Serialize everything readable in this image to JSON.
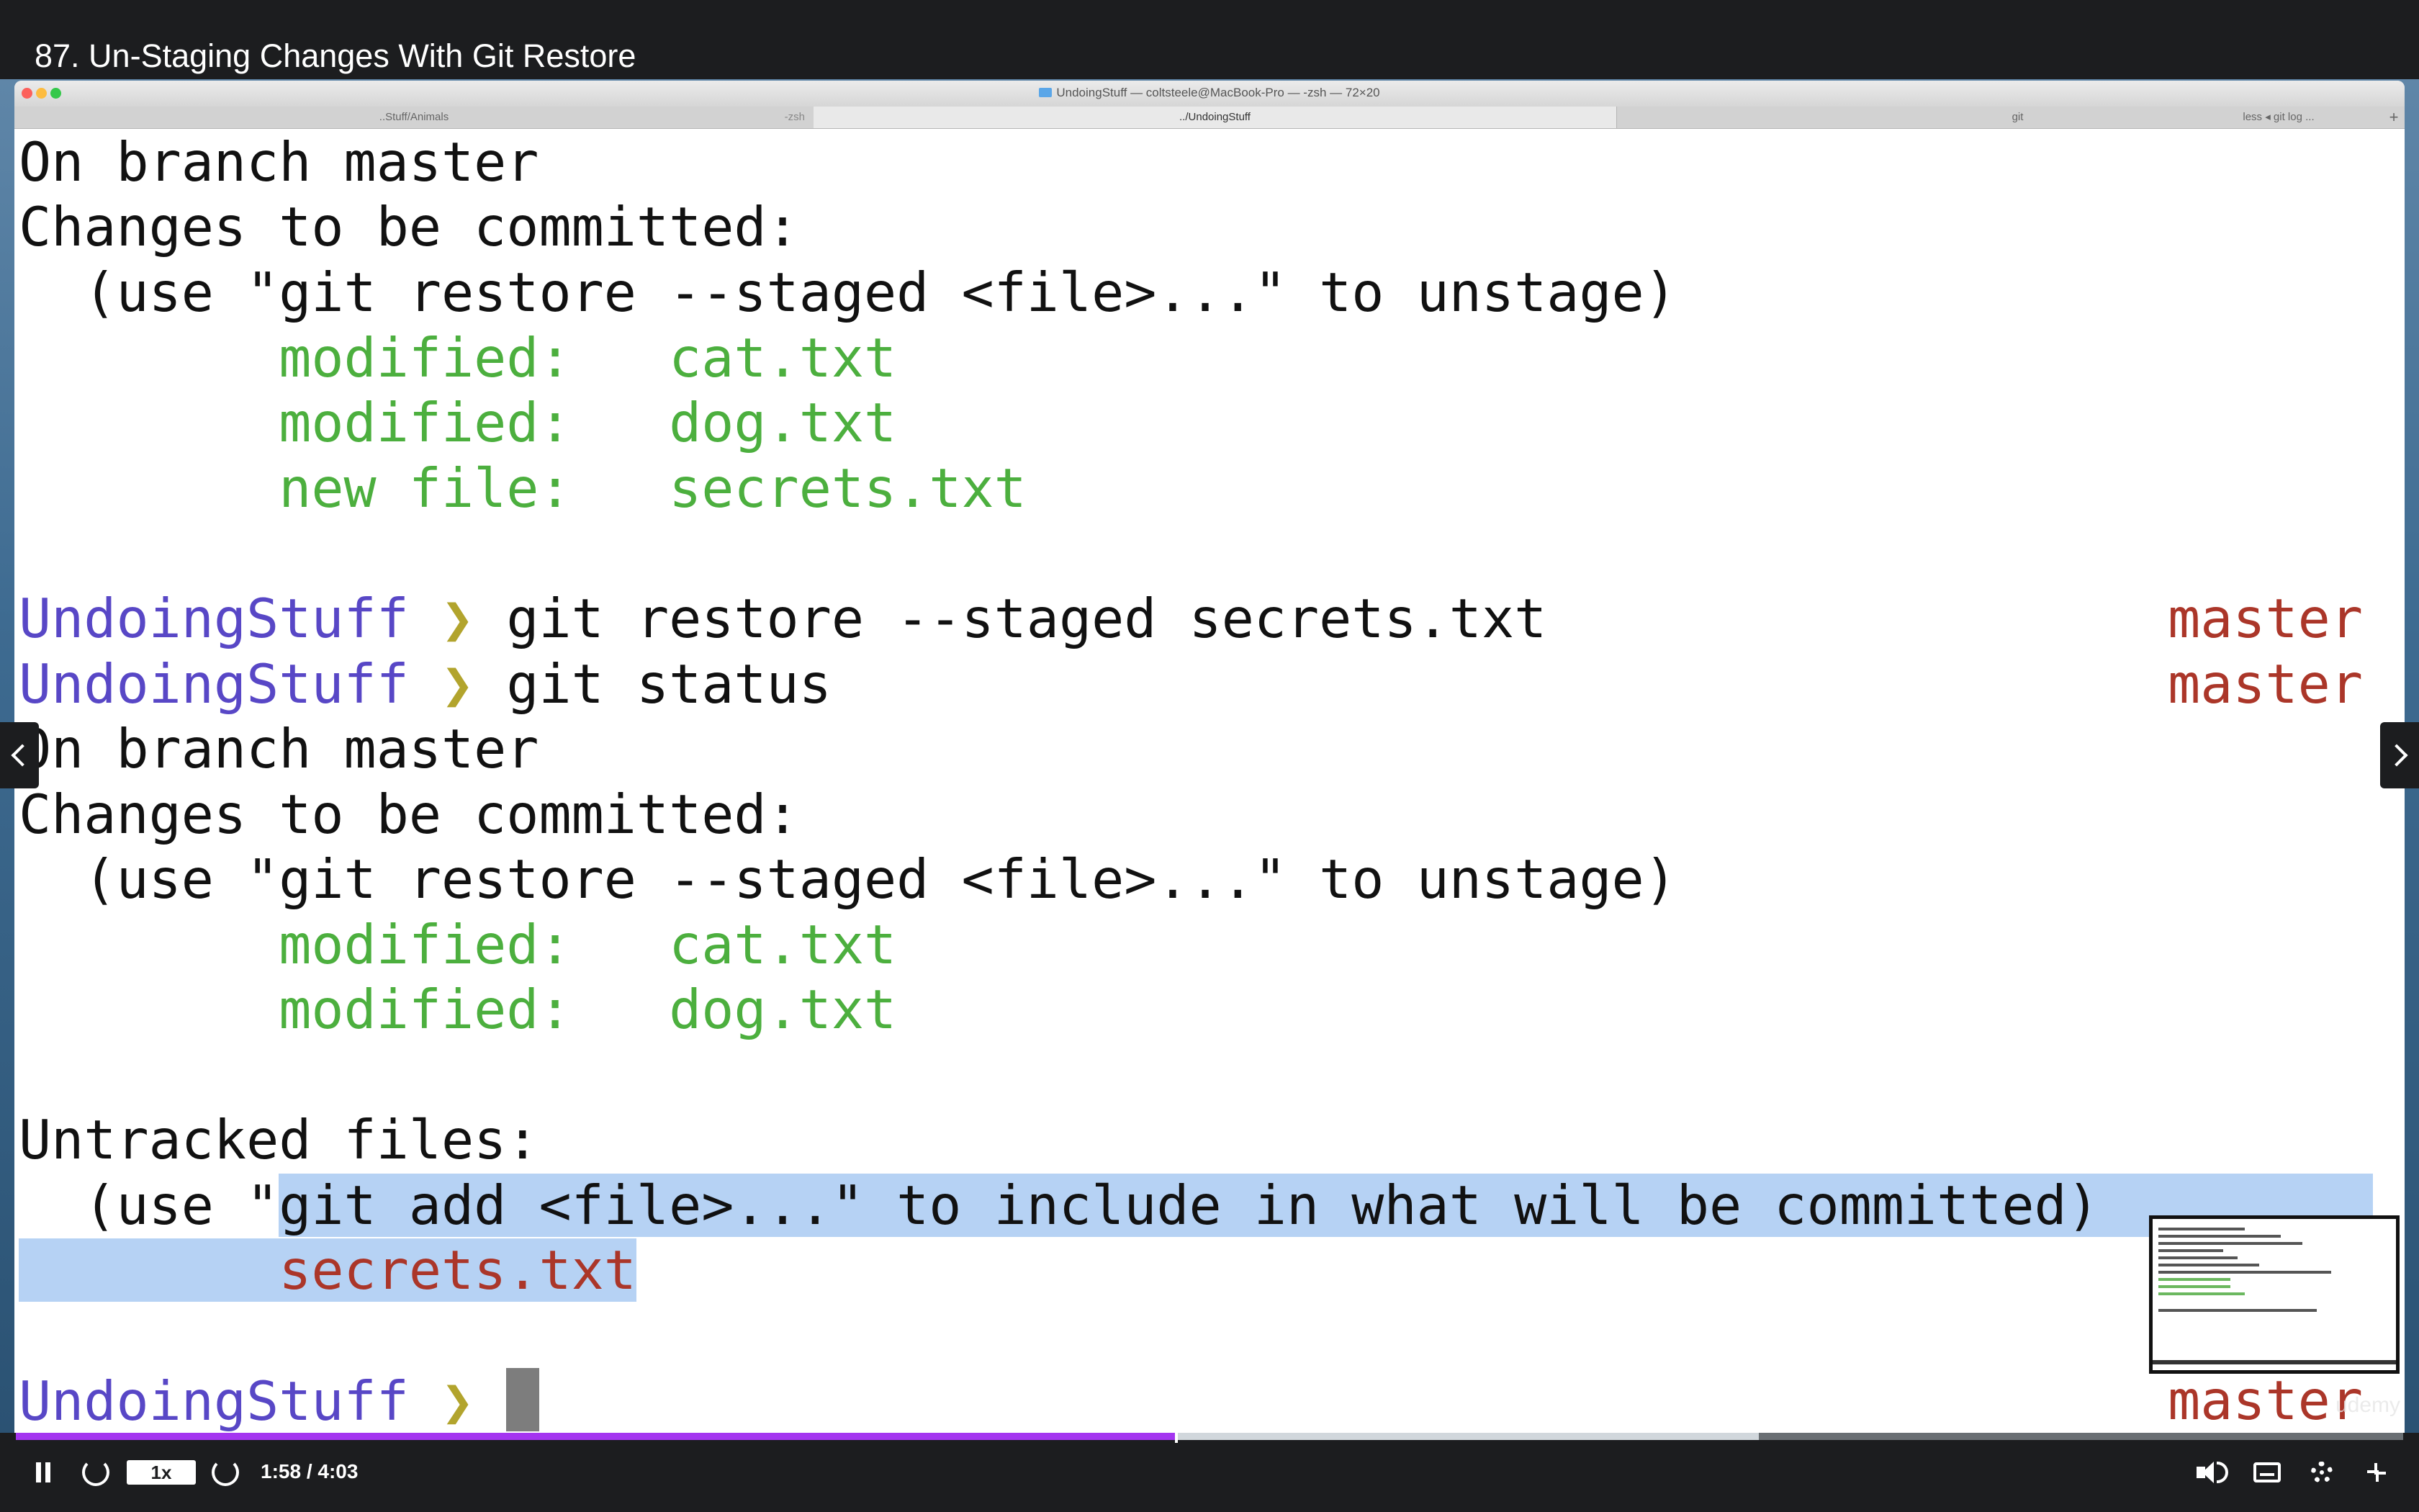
{
  "header": {
    "lecture_title": "87. Un-Staging Changes With Git Restore"
  },
  "window": {
    "title": "UndoingStuff — coltsteele@MacBook-Pro — -zsh — 72×20",
    "tabs": [
      {
        "label": "..Stuff/Animals",
        "sub": "-zsh"
      },
      {
        "label": "../UndoingStuff"
      },
      {
        "label": "git"
      },
      {
        "label": "less ◂ git log ..."
      }
    ],
    "add_tab": "+"
  },
  "terminal": {
    "l1": "On branch master",
    "l2": "Changes to be committed:",
    "l3": "  (use \"git restore --staged <file>...\" to unstage)",
    "l4_status": "        modified:   cat.txt",
    "l5_status": "        modified:   dog.txt",
    "l6_status": "        new file:   secrets.txt",
    "prompt_dir": "UndoingStuff",
    "prompt_symbol": "❯",
    "cmd1": "git restore --staged secrets.txt",
    "cmd2": "git status",
    "branch": "master",
    "l10": "On branch master",
    "l11": "Changes to be committed:",
    "l12": "  (use \"git restore --staged <file>...\" to unstage)",
    "l13_status": "        modified:   cat.txt",
    "l14_status": "        modified:   dog.txt",
    "l16": "Untracked files:",
    "l17_pre": "  (use \"",
    "l17_sel": "git add <file>...\" to include in what will be committed)",
    "l18_pad": "        ",
    "l18_file": "secrets.txt"
  },
  "watermark": "udemy",
  "player": {
    "progress_fraction": 0.486,
    "buffered_fraction": 0.73,
    "speed": "1x",
    "time": "1:58 / 4:03"
  },
  "colors": {
    "progress": "#a435f0",
    "prompt": "#5847c6",
    "branch": "#ab3629",
    "status_green": "#4caf3e",
    "selection": "#b6d2f4"
  },
  "icons": [
    "folder-icon",
    "chevron-left-icon",
    "chevron-right-icon",
    "pause-icon",
    "rewind-icon",
    "forward-icon",
    "volume-icon",
    "captions-icon",
    "gear-icon",
    "exit-fullscreen-icon"
  ]
}
